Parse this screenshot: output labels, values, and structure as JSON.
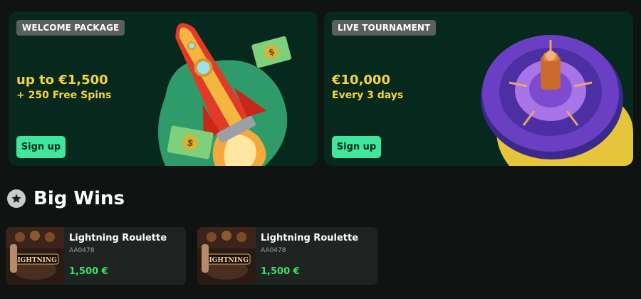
{
  "promos": [
    {
      "tag": "WELCOME PACKAGE",
      "headline": "up to €1,500",
      "subline": "+ 250 Free Spins",
      "button": "Sign up",
      "art_icons": [
        "rocket",
        "dollar-bill",
        "dollar-bill"
      ]
    },
    {
      "tag": "LIVE TOURNAMENT",
      "headline": "€10,000",
      "subline": "Every 3 days",
      "button": "Sign up",
      "art_icons": [
        "roulette-wheel"
      ]
    }
  ],
  "big_wins": {
    "title": "Big Wins",
    "icon": "star-icon",
    "items": [
      {
        "game": "Lightning Roulette",
        "player": "AA0478",
        "amount": "1,500 €",
        "thumb_text": "LIGHTNING"
      },
      {
        "game": "Lightning Roulette",
        "player": "AA0478",
        "amount": "1,500 €",
        "thumb_text": "LIGHTNING"
      }
    ]
  },
  "colors": {
    "background": "#0f1311",
    "banner": "#06281d",
    "accent_green": "#3ee79b",
    "headline_yellow": "#f5d53c",
    "win_amount": "#3ee065"
  }
}
